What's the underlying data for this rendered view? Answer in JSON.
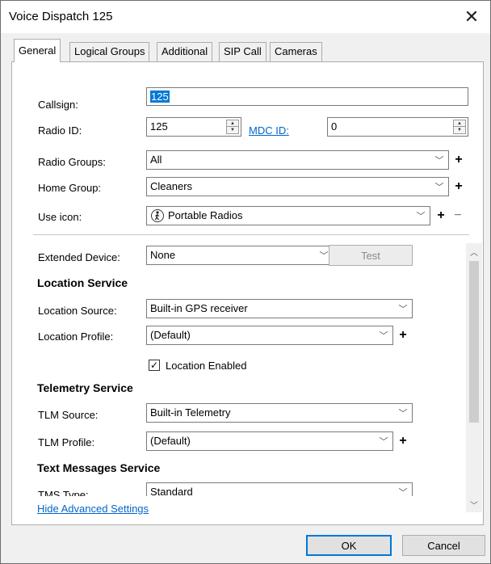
{
  "window": {
    "title": "Voice Dispatch 125",
    "close": "✕"
  },
  "tabs": [
    "General",
    "Logical Groups",
    "Additional",
    "SIP Call",
    "Cameras"
  ],
  "fields": {
    "callsign": {
      "label": "Callsign:",
      "value": "125"
    },
    "radio_id": {
      "label": "Radio ID:",
      "value": "125"
    },
    "mdc_id": {
      "label": "MDC ID:",
      "value": "0"
    },
    "radio_groups": {
      "label": "Radio Groups:",
      "value": "All"
    },
    "home_group": {
      "label": "Home Group:",
      "value": "Cleaners"
    },
    "use_icon": {
      "label": "Use icon:",
      "value": "Portable Radios",
      "icon": "walking-person-icon"
    },
    "extended_device": {
      "label": "Extended Device:",
      "value": "None",
      "test_label": "Test"
    }
  },
  "location_service": {
    "heading": "Location Service",
    "source_label": "Location Source:",
    "source_value": "Built-in GPS receiver",
    "profile_label": "Location Profile:",
    "profile_value": "(Default)",
    "enabled_label": "Location Enabled",
    "enabled_checked": true
  },
  "telemetry_service": {
    "heading": "Telemetry Service",
    "source_label": "TLM Source:",
    "source_value": "Built-in Telemetry",
    "profile_label": "TLM Profile:",
    "profile_value": "(Default)"
  },
  "text_messages_service": {
    "heading": "Text Messages Service",
    "type_label": "TMS Type:",
    "type_value": "Standard"
  },
  "links": {
    "hide_advanced": "Hide Advanced Settings"
  },
  "buttons": {
    "ok": "OK",
    "cancel": "Cancel"
  },
  "glyphs": {
    "plus": "+",
    "minus": "−",
    "chevron": "﹀",
    "check": "✓",
    "up": "▲",
    "down": "▼",
    "scroll_up": "︿",
    "scroll_down": "﹀"
  },
  "colors": {
    "accent": "#0078d7",
    "link": "#0066cc"
  }
}
